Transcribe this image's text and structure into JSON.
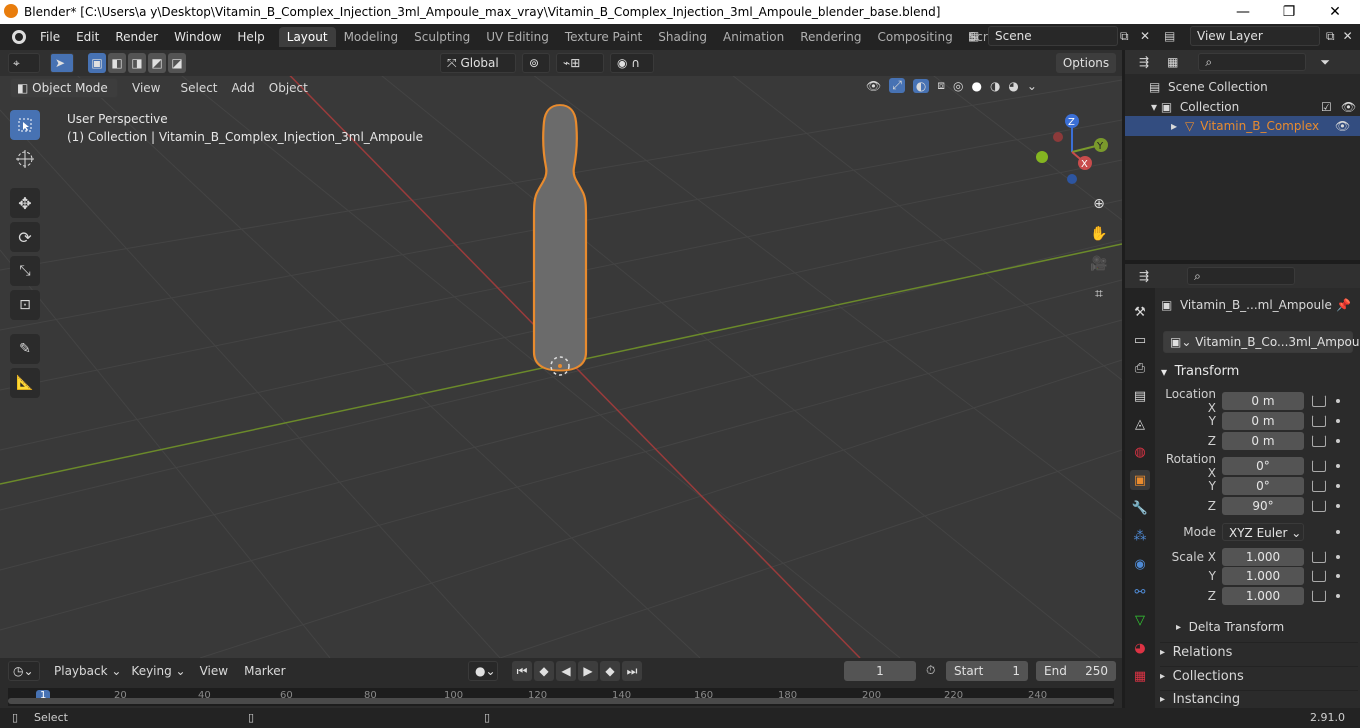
{
  "window": {
    "title": "Blender* [C:\\Users\\a y\\Desktop\\Vitamin_B_Complex_Injection_3ml_Ampoule_max_vray\\Vitamin_B_Complex_Injection_3ml_Ampoule_blender_base.blend]",
    "minimize": "—",
    "maximize": "❐",
    "close": "✕"
  },
  "menu": [
    "File",
    "Edit",
    "Render",
    "Window",
    "Help"
  ],
  "workspaces": [
    "Layout",
    "Modeling",
    "Sculpting",
    "UV Editing",
    "Texture Paint",
    "Shading",
    "Animation",
    "Rendering",
    "Compositing",
    "Scripting"
  ],
  "active_workspace": "Layout",
  "scene": {
    "label": "Scene"
  },
  "view_layer": {
    "label": "View Layer"
  },
  "toolbar": {
    "orientation": "Global",
    "options": "Options"
  },
  "viewport_header": {
    "mode": "Object Mode",
    "menus": [
      "View",
      "Select",
      "Add",
      "Object"
    ]
  },
  "overlay": {
    "perspective": "User Perspective",
    "collection": "(1) Collection | Vitamin_B_Complex_Injection_3ml_Ampoule"
  },
  "gizmo": {
    "z": "Z",
    "y": "Y",
    "x": "X"
  },
  "outliner": {
    "scene_collection": "Scene Collection",
    "collection": "Collection",
    "object": "Vitamin_B_Complex"
  },
  "properties": {
    "object_name": "Vitamin_B_...ml_Ampoule",
    "object_field": "Vitamin_B_Co...3ml_Ampoule",
    "transform_header": "Transform",
    "location": {
      "x_label": "Location X",
      "y_label": "Y",
      "z_label": "Z",
      "x": "0 m",
      "y": "0 m",
      "z": "0 m"
    },
    "rotation": {
      "x_label": "Rotation X",
      "y_label": "Y",
      "z_label": "Z",
      "x": "0°",
      "y": "0°",
      "z": "90°"
    },
    "mode_label": "Mode",
    "mode_value": "XYZ Euler",
    "scale": {
      "x_label": "Scale X",
      "y_label": "Y",
      "z_label": "Z",
      "x": "1.000",
      "y": "1.000",
      "z": "1.000"
    },
    "delta_transform": "Delta Transform",
    "sections": [
      "Relations",
      "Collections",
      "Instancing"
    ]
  },
  "timeline": {
    "menus": [
      "Playback",
      "Keying",
      "View",
      "Marker"
    ],
    "current_frame": "1",
    "start_label": "Start",
    "start": "1",
    "end_label": "End",
    "end": "250",
    "ruler": [
      "1",
      "20",
      "40",
      "60",
      "80",
      "100",
      "120",
      "140",
      "160",
      "180",
      "200",
      "220",
      "240"
    ]
  },
  "status": {
    "left": "Select",
    "version": "2.91.0"
  },
  "colors": {
    "accent": "#4772b3",
    "selection": "#e88b2e",
    "x_axis": "#c84c4c",
    "y_axis": "#7a9a2c",
    "z_axis": "#3b6fd6"
  }
}
